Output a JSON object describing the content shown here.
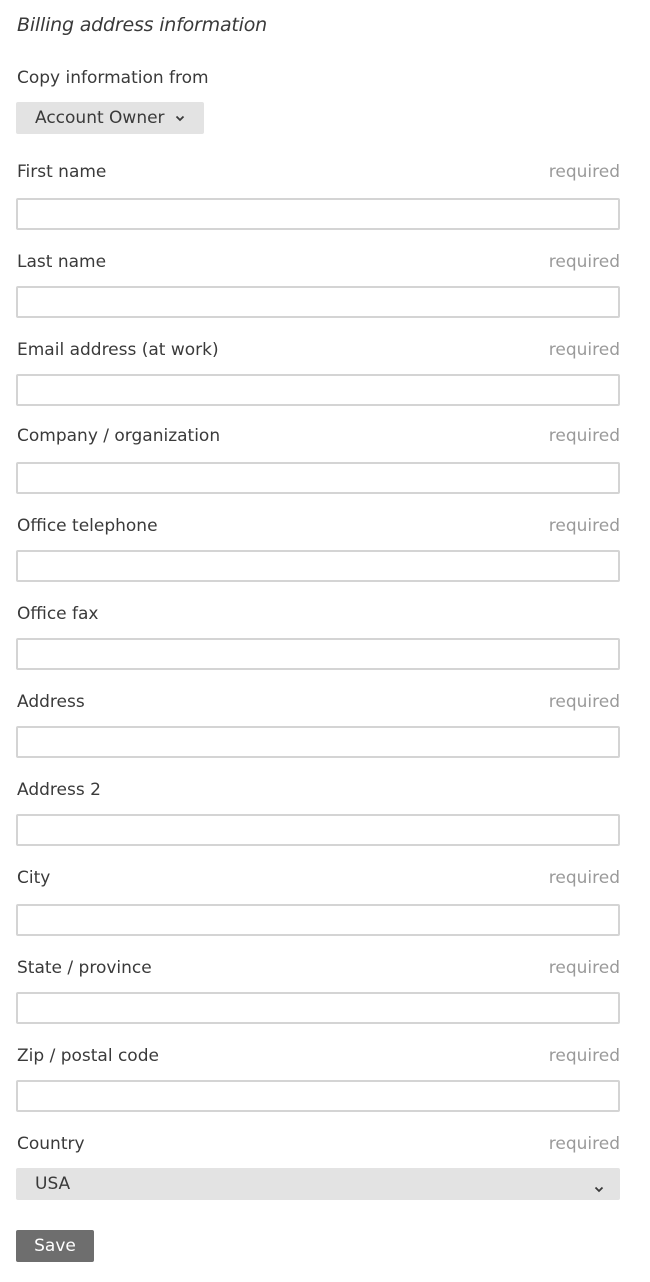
{
  "section_title": "Billing address information",
  "copy_from": {
    "label": "Copy information from",
    "selected": "Account Owner",
    "chevron_icon": "chevron-down-icon"
  },
  "required_text": "required",
  "fields": {
    "first_name": {
      "label": "First name",
      "value": "",
      "required": "required"
    },
    "last_name": {
      "label": "Last name",
      "value": "",
      "required": "required"
    },
    "email": {
      "label": "Email address (at work)",
      "value": "",
      "required": "required"
    },
    "company": {
      "label": "Company / organization",
      "value": "",
      "required": "required"
    },
    "office_telephone": {
      "label": "Office telephone",
      "value": "",
      "required": "required"
    },
    "office_fax": {
      "label": "Office fax",
      "value": ""
    },
    "address": {
      "label": "Address",
      "value": "",
      "required": "required"
    },
    "address2": {
      "label": "Address 2",
      "value": ""
    },
    "city": {
      "label": "City",
      "value": "",
      "required": "required"
    },
    "state": {
      "label": "State / province",
      "value": "",
      "required": "required"
    },
    "zip": {
      "label": "Zip / postal code",
      "value": "",
      "required": "required"
    },
    "country": {
      "label": "Country",
      "selected": "USA",
      "required": "required"
    }
  },
  "save_label": "Save",
  "colors": {
    "text": "#3a3a3a",
    "muted": "#9a9a9a",
    "input_border": "#d4d4d4",
    "select_bg": "#e3e3e3",
    "button_bg": "#6e6e6e"
  }
}
